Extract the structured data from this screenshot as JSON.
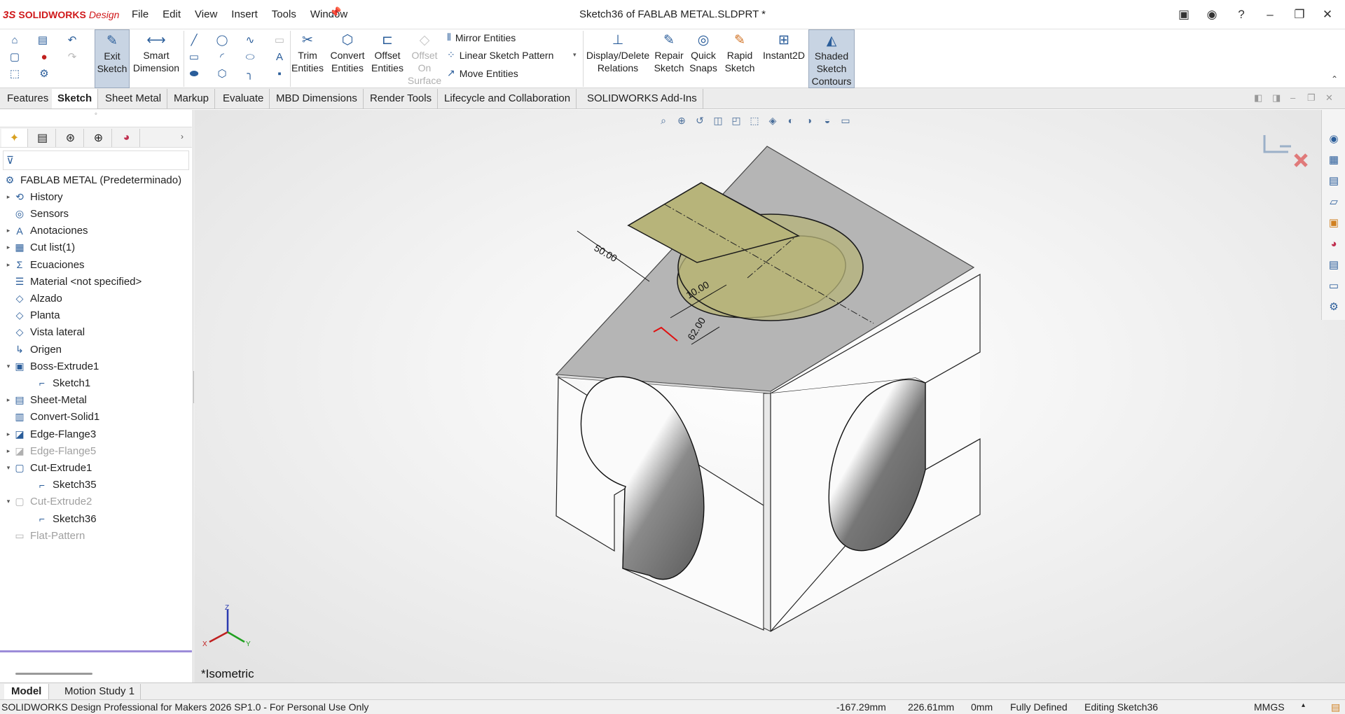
{
  "app": {
    "logo_ds": "3S",
    "logo_brand": "SOLIDWORKS",
    "logo_suffix": "Design",
    "menus": [
      "File",
      "Edit",
      "View",
      "Insert",
      "Tools",
      "Window"
    ],
    "title": "Sketch36 of FABLAB METAL.SLDPRT *"
  },
  "toolbar": {
    "exit_sketch": [
      "Exit",
      "Sketch"
    ],
    "smart_dimension": [
      "Smart",
      "Dimension"
    ],
    "trim_entities": [
      "Trim",
      "Entities"
    ],
    "convert_entities": [
      "Convert",
      "Entities"
    ],
    "offset_entities": [
      "Offset",
      "Entities"
    ],
    "offset_on_surface": [
      "Offset",
      "On",
      "Surface"
    ],
    "mirror_entities": "Mirror Entities",
    "linear_sketch_pattern": "Linear Sketch Pattern",
    "move_entities": "Move Entities",
    "display_delete_relations": [
      "Display/Delete",
      "Relations"
    ],
    "repair_sketch": [
      "Repair",
      "Sketch"
    ],
    "quick_snaps": [
      "Quick",
      "Snaps"
    ],
    "rapid_sketch": [
      "Rapid",
      "Sketch"
    ],
    "instant2d": "Instant2D",
    "shaded_sketch_contours": [
      "Shaded",
      "Sketch",
      "Contours"
    ]
  },
  "tabs": [
    "Features",
    "Sketch",
    "Sheet Metal",
    "Markup",
    "Evaluate",
    "MBD Dimensions",
    "Render Tools",
    "Lifecycle and Collaboration",
    "SOLIDWORKS Add-Ins"
  ],
  "active_tab": "Sketch",
  "tree": [
    {
      "label": "FABLAB METAL  (Predeterminado)",
      "icon": "part-icon",
      "expand": "",
      "indent": 0,
      "grey": false
    },
    {
      "label": "History",
      "icon": "history-icon",
      "expand": "▸",
      "indent": 1,
      "grey": false
    },
    {
      "label": "Sensors",
      "icon": "sensor-icon",
      "expand": "",
      "indent": 1,
      "grey": false
    },
    {
      "label": "Anotaciones",
      "icon": "annotation-icon",
      "expand": "▸",
      "indent": 1,
      "grey": false
    },
    {
      "label": "Cut list(1)",
      "icon": "cutlist-icon",
      "expand": "▸",
      "indent": 1,
      "grey": false
    },
    {
      "label": "Ecuaciones",
      "icon": "equation-icon",
      "expand": "▸",
      "indent": 1,
      "grey": false
    },
    {
      "label": "Material <not specified>",
      "icon": "material-icon",
      "expand": "",
      "indent": 1,
      "grey": false
    },
    {
      "label": "Alzado",
      "icon": "plane-icon",
      "expand": "",
      "indent": 1,
      "grey": false
    },
    {
      "label": "Planta",
      "icon": "plane-icon",
      "expand": "",
      "indent": 1,
      "grey": false
    },
    {
      "label": "Vista lateral",
      "icon": "plane-icon",
      "expand": "",
      "indent": 1,
      "grey": false
    },
    {
      "label": "Origen",
      "icon": "origin-icon",
      "expand": "",
      "indent": 1,
      "grey": false
    },
    {
      "label": "Boss-Extrude1",
      "icon": "boss-extrude-icon",
      "expand": "▾",
      "indent": 1,
      "grey": false
    },
    {
      "label": "Sketch1",
      "icon": "sketch-icon",
      "expand": "",
      "indent": 2,
      "grey": false
    },
    {
      "label": "Sheet-Metal",
      "icon": "sheet-metal-icon",
      "expand": "▸",
      "indent": 1,
      "grey": false
    },
    {
      "label": "Convert-Solid1",
      "icon": "convert-solid-icon",
      "expand": "",
      "indent": 1,
      "grey": false
    },
    {
      "label": "Edge-Flange3",
      "icon": "edge-flange-icon",
      "expand": "▸",
      "indent": 1,
      "grey": false
    },
    {
      "label": "Edge-Flange5",
      "icon": "edge-flange-icon",
      "expand": "▸",
      "indent": 1,
      "grey": true
    },
    {
      "label": "Cut-Extrude1",
      "icon": "cut-extrude-icon",
      "expand": "▾",
      "indent": 1,
      "grey": false
    },
    {
      "label": "Sketch35",
      "icon": "sketch-icon",
      "expand": "",
      "indent": 2,
      "grey": false
    },
    {
      "label": "Cut-Extrude2",
      "icon": "cut-extrude-icon",
      "expand": "▾",
      "indent": 1,
      "grey": true
    },
    {
      "label": "Sketch36",
      "icon": "sketch-icon",
      "expand": "",
      "indent": 2,
      "grey": false
    },
    {
      "label": "Flat-Pattern",
      "icon": "flat-pattern-icon",
      "expand": "",
      "indent": 1,
      "grey": true
    }
  ],
  "viewport": {
    "view_name": "*Isometric",
    "dimensions": [
      "50.00",
      "10.00",
      "62.00"
    ],
    "triad": {
      "x": "X",
      "y": "Y",
      "z": "Z"
    }
  },
  "bottom_tabs": [
    "Model",
    "Motion Study 1"
  ],
  "status": {
    "product": "SOLIDWORKS Design Professional for Makers 2026 SP1.0 - For Personal Use Only",
    "x": "-167.29mm",
    "y": "226.61mm",
    "z": "0mm",
    "state": "Fully Defined",
    "editing": "Editing Sketch36",
    "units": "MMGS"
  },
  "colors": {
    "sketch_fill": "#b7b47a",
    "tab_bg": "#ececec",
    "accent_red": "#d0191b"
  }
}
